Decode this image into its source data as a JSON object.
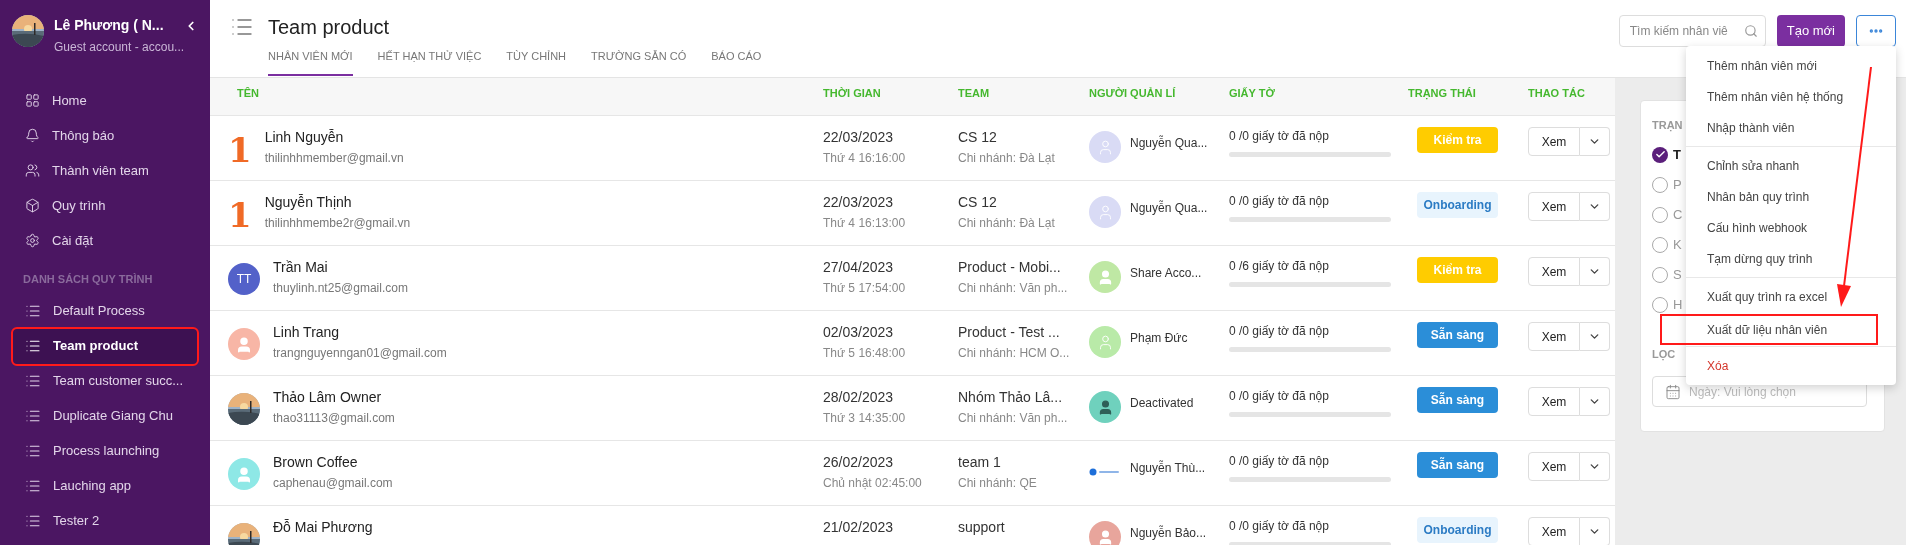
{
  "sidebar": {
    "user": {
      "name": "Lê Phương ( N...",
      "subtitle": "Guest account - accou..."
    },
    "nav": [
      {
        "label": "Home"
      },
      {
        "label": "Thông báo"
      },
      {
        "label": "Thành viên team"
      },
      {
        "label": "Quy trình"
      },
      {
        "label": "Cài đặt"
      }
    ],
    "section_title": "DANH SÁCH QUY TRÌNH",
    "processes": [
      {
        "label": "Default Process",
        "selected": false,
        "highlighted": false
      },
      {
        "label": "Team product",
        "selected": true,
        "highlighted": true
      },
      {
        "label": "Team customer succ...",
        "selected": false,
        "highlighted": false
      },
      {
        "label": "Duplicate Giang Chu",
        "selected": false,
        "highlighted": false
      },
      {
        "label": "Process launching",
        "selected": false,
        "highlighted": false
      },
      {
        "label": "Lauching app",
        "selected": false,
        "highlighted": false
      },
      {
        "label": "Tester 2",
        "selected": false,
        "highlighted": false
      }
    ]
  },
  "header": {
    "title": "Team product",
    "tabs": [
      {
        "label": "NHÂN VIÊN MỚI",
        "selected": true
      },
      {
        "label": "HẾT HẠN THỬ VIỆC",
        "selected": false
      },
      {
        "label": "TÙY CHỈNH",
        "selected": false
      },
      {
        "label": "TRƯỜNG SẴN CÓ",
        "selected": false
      },
      {
        "label": "BÁO CÁO",
        "selected": false
      }
    ],
    "search": {
      "placeholder": "Tìm kiếm nhân viê"
    },
    "create_button": "Tạo mới"
  },
  "table": {
    "columns": [
      "TÊN",
      "THỜI GIAN",
      "TEAM",
      "NGƯỜI QUẢN LÍ",
      "GIẤY TỜ",
      "TRẠNG THÁI",
      "THAO TÁC"
    ],
    "rows": [
      {
        "avatar": {
          "kind": "number",
          "text": "1"
        },
        "name": "Linh Nguyễn",
        "email": "thilinhhmember@gmail.vn",
        "date": "22/03/2023",
        "time": "Thứ 4 16:16:00",
        "team": "CS 12",
        "branch": "Chi nhánh: Đà Lạt",
        "manager": {
          "kind": "outline",
          "color": "#d9dbf5",
          "name": "Nguyễn Qua..."
        },
        "docs": "0 /0 giấy tờ đã nộp",
        "level": 0,
        "status": {
          "kind": "check",
          "label": "Kiểm tra"
        },
        "action": "Xem"
      },
      {
        "avatar": {
          "kind": "number",
          "text": "1"
        },
        "name": "Nguyễn Thịnh",
        "email": "thilinhhmembe2r@gmail.vn",
        "date": "22/03/2023",
        "time": "Thứ 4 16:13:00",
        "team": "CS 12",
        "branch": "Chi nhánh: Đà Lạt",
        "manager": {
          "kind": "outline",
          "color": "#d9dbf5",
          "name": "Nguyễn Qua..."
        },
        "docs": "0 /0 giấy tờ đã nộp",
        "level": 0,
        "status": {
          "kind": "onboarding",
          "label": "Onboarding"
        },
        "action": "Xem"
      },
      {
        "avatar": {
          "kind": "initials",
          "text": "TT",
          "color": "#5361c9"
        },
        "name": "Trần Mai",
        "email": "thuylinh.nt25@gmail.com",
        "date": "27/04/2023",
        "time": "Thứ 5 17:54:00",
        "team": "Product - Mobi...",
        "branch": "Chi nhánh: Văn ph...",
        "manager": {
          "kind": "solid",
          "color": "#bfe8a4",
          "name": "Share Acco..."
        },
        "docs": "0 /6 giấy tờ đã nộp",
        "level": 0,
        "status": {
          "kind": "check",
          "label": "Kiểm tra"
        },
        "action": "Xem"
      },
      {
        "avatar": {
          "kind": "person",
          "color": "#f8b6a6"
        },
        "name": "Linh Trang",
        "email": "trangnguyenngan01@gmail.com",
        "date": "02/03/2023",
        "time": "Thứ 5 16:48:00",
        "team": "Product - Test ...",
        "branch": "Chi nhánh: HCM O...",
        "manager": {
          "kind": "outline",
          "color": "#b9eaa8",
          "name": "Phạm Đức"
        },
        "docs": "0 /0 giấy tờ đã nộp",
        "level": 0,
        "status": {
          "kind": "ready",
          "label": "Sẵn sàng"
        },
        "action": "Xem"
      },
      {
        "name": "Thảo Lâm Owner",
        "email": "thao31113@gmail.com",
        "date": "28/02/2023",
        "time": "Thứ 3 14:35:00",
        "team": "Nhóm Thảo Lâ...",
        "branch": "Chi nhánh: Văn ph...",
        "manager": {
          "kind": "dark",
          "color": "#6fd1bd",
          "name": "Deactivated"
        },
        "docs": "0 /0 giấy tờ đã nộp",
        "level": 0,
        "status": {
          "kind": "ready",
          "label": "Sẵn sàng"
        },
        "action": "Xem"
      },
      {
        "avatar": {
          "kind": "person",
          "color": "#8ee8e6"
        },
        "name": "Brown Coffee",
        "email": "caphenau@gmail.com",
        "date": "26/02/2023",
        "time": "Chủ nhật 02:45:00",
        "team": "team 1",
        "branch": "Chi nhánh: QE",
        "manager": {
          "kind": "logo",
          "name": "Nguyễn Thù..."
        },
        "docs": "0 /0 giấy tờ đã nộp",
        "level": 0,
        "status": {
          "kind": "ready",
          "label": "Sẵn sàng"
        },
        "action": "Xem"
      },
      {
        "name": "Đỗ Mai Phương",
        "date": "21/02/2023",
        "team": "support",
        "manager": {
          "kind": "solid",
          "color": "#e8a59c",
          "name": "Nguyễn Bảo..."
        },
        "docs": "0 /0 giấy tờ đã nộp",
        "level": 0,
        "status": {
          "kind": "onboarding",
          "label": "Onboarding"
        },
        "action": "Xem"
      }
    ]
  },
  "filter_panel": {
    "title": "TRẠN",
    "options": [
      {
        "label": "T",
        "selected": true
      },
      {
        "label": "P",
        "selected": false
      },
      {
        "label": "C",
        "selected": false
      },
      {
        "label": "K",
        "selected": false
      },
      {
        "label": "S",
        "selected": false
      },
      {
        "label": "H",
        "selected": false
      }
    ],
    "date_title": "LỌC",
    "date_placeholder": "Ngày: Vui lòng chọn"
  },
  "menu": {
    "groups": [
      [
        {
          "label": "Thêm nhân viên mới",
          "danger": false,
          "highlighted": false
        },
        {
          "label": "Thêm nhân viên hệ thống",
          "danger": false,
          "highlighted": false
        },
        {
          "label": "Nhập thành viên",
          "danger": false,
          "highlighted": false
        }
      ],
      [
        {
          "label": "Chỉnh sửa nhanh",
          "danger": false,
          "highlighted": false
        },
        {
          "label": "Nhân bản quy trình",
          "danger": false,
          "highlighted": false
        },
        {
          "label": "Cấu hình webhook",
          "danger": false,
          "highlighted": false
        },
        {
          "label": "Tạm dừng quy trình",
          "danger": false,
          "highlighted": false
        }
      ],
      [
        {
          "label": "Xuất quy trình ra excel",
          "danger": false,
          "highlighted": false
        },
        {
          "label": "Xuất dữ liệu nhân viên",
          "danger": false,
          "highlighted": true
        }
      ],
      [
        {
          "label": "Xóa",
          "danger": true,
          "highlighted": false
        }
      ]
    ]
  }
}
